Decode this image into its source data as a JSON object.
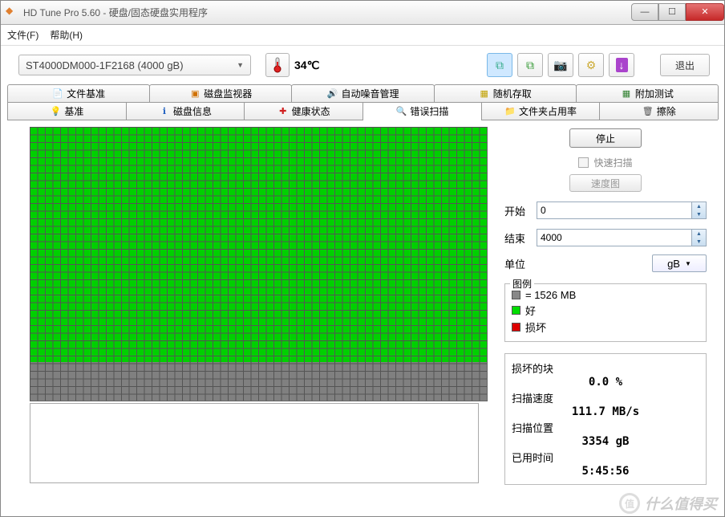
{
  "window": {
    "title": "HD Tune Pro 5.60 - 硬盘/固态硬盘实用程序"
  },
  "menu": {
    "file": "文件(F)",
    "help": "帮助(H)"
  },
  "toolbar": {
    "drive": "ST4000DM000-1F2168 (4000 gB)",
    "temp": "34℃",
    "exit": "退出"
  },
  "tabs_top": [
    {
      "icon": "📄",
      "color": "#c0a000",
      "label": "文件基准"
    },
    {
      "icon": "▣",
      "color": "#d07000",
      "label": "磁盘监视器"
    },
    {
      "icon": "🔊",
      "color": "#d0a000",
      "label": "自动噪音管理"
    },
    {
      "icon": "▦",
      "color": "#c0a000",
      "label": "随机存取"
    },
    {
      "icon": "▦",
      "color": "#308030",
      "label": "附加测试"
    }
  ],
  "tabs_bottom": [
    {
      "icon": "💡",
      "color": "#d0b000",
      "label": "基准"
    },
    {
      "icon": "ℹ",
      "color": "#2060c0",
      "label": "磁盘信息"
    },
    {
      "icon": "✚",
      "color": "#d02020",
      "label": "健康状态"
    },
    {
      "icon": "🔍",
      "color": "#206020",
      "label": "错误扫描",
      "active": true
    },
    {
      "icon": "📁",
      "color": "#d0a020",
      "label": "文件夹占用率"
    },
    {
      "icon": "🗑",
      "color": "#505050",
      "label": "擦除"
    }
  ],
  "side": {
    "stop": "停止",
    "quick": "快速扫描",
    "speedmap": "速度图",
    "start_label": "开始",
    "start_value": "0",
    "end_label": "结束",
    "end_value": "4000",
    "unit_label": "单位",
    "unit_value": "gB"
  },
  "legend": {
    "title": "图例",
    "block": "= 1526 MB",
    "good": "好",
    "bad": "损坏"
  },
  "stats": {
    "damaged_label": "损坏的块",
    "damaged_value": "0.0 %",
    "speed_label": "扫描速度",
    "speed_value": "111.7 MB/s",
    "pos_label": "扫描位置",
    "pos_value": "3354 gB",
    "time_label": "已用时间",
    "time_value": "5:45:56"
  },
  "watermark": "什么值得买"
}
